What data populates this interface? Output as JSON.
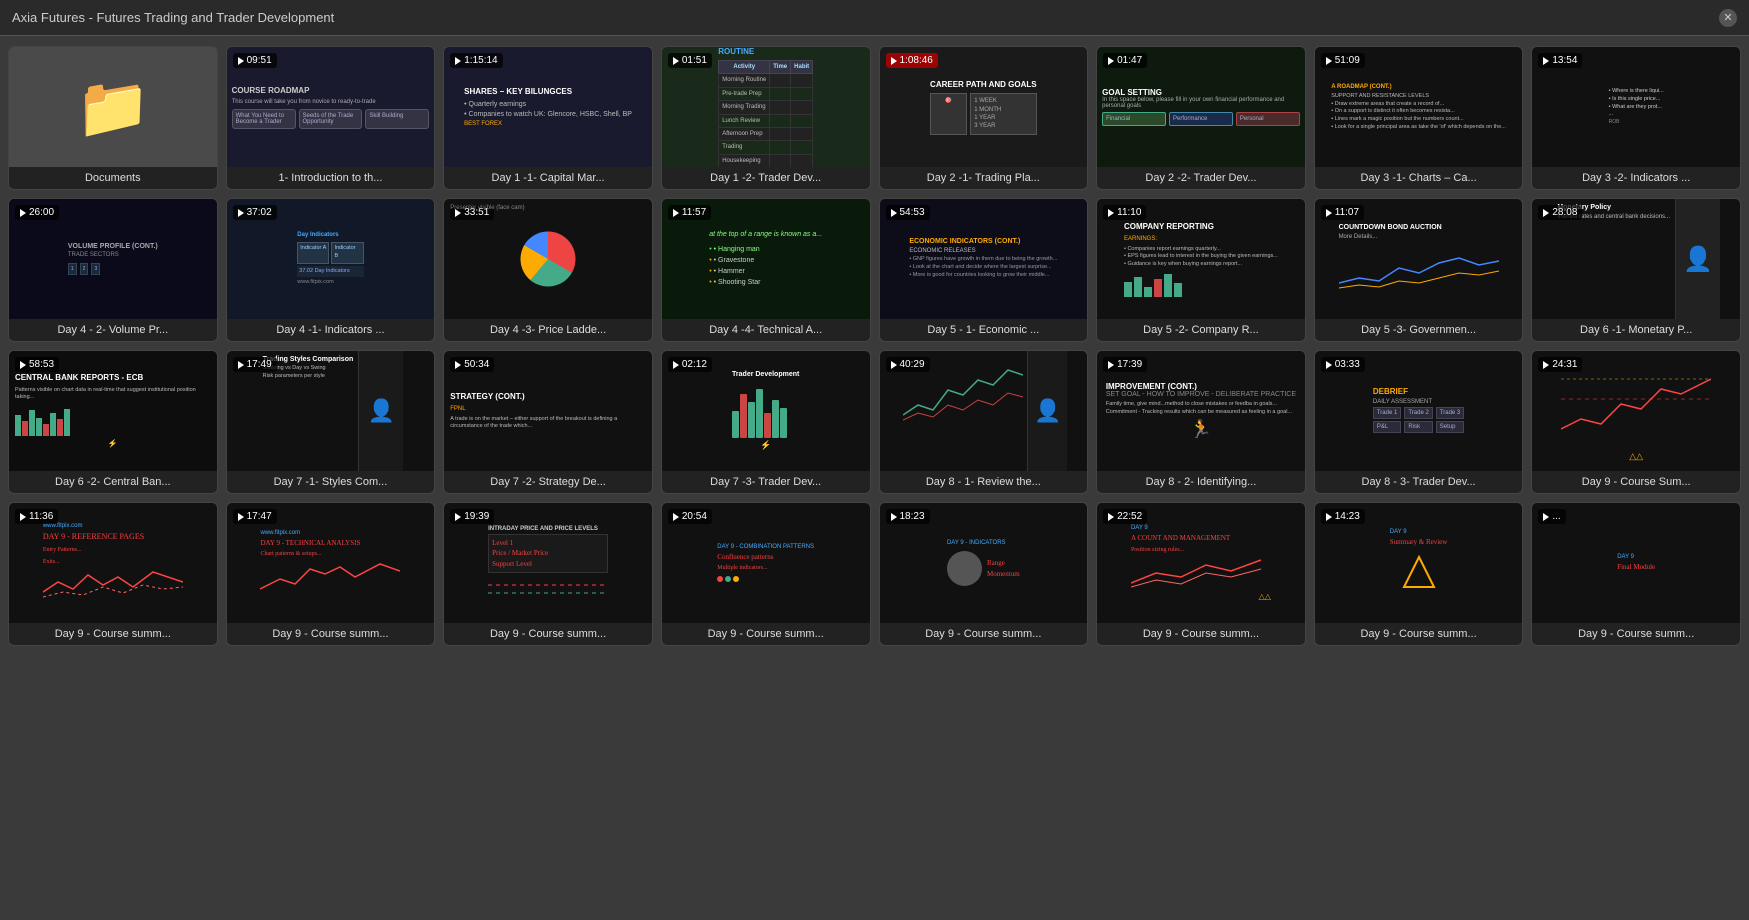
{
  "app": {
    "title": "Axia Futures - Futures Trading and Trader Development"
  },
  "grid": {
    "items": [
      {
        "id": "documents",
        "label": "Documents",
        "duration": null,
        "type": "folder",
        "is_folder": true
      },
      {
        "id": "day1-intro",
        "label": "1- Introduction to th...",
        "duration": "09:51",
        "type": "video",
        "duration_red": false
      },
      {
        "id": "day1-capital",
        "label": "Day 1 -1- Capital Mar...",
        "duration": "1:15:14",
        "type": "video",
        "duration_red": false
      },
      {
        "id": "day1-trader-dev",
        "label": "Day 1 -2- Trader Dev...",
        "duration": "01:51",
        "type": "video",
        "duration_red": false
      },
      {
        "id": "day2-trading-plan",
        "label": "Day 2 -1- Trading Pla...",
        "duration": "1:08:46",
        "type": "video",
        "duration_red": true
      },
      {
        "id": "day2-trader-dev",
        "label": "Day 2 -2- Trader Dev...",
        "duration": "01:47",
        "type": "video",
        "duration_red": false
      },
      {
        "id": "day3-charts",
        "label": "Day 3 -1- Charts – Ca...",
        "duration": "51:09",
        "type": "video",
        "duration_red": false
      },
      {
        "id": "day3-indicators",
        "label": "Day 3 -2- Indicators ...",
        "duration": "13:54",
        "type": "video",
        "duration_red": false
      },
      {
        "id": "day4-volume",
        "label": "Day 4 - 2- Volume Pr...",
        "duration": "26:00",
        "type": "video",
        "duration_red": false
      },
      {
        "id": "day4-indicators",
        "label": "Day 4 -1- Indicators ...",
        "duration": "37:02",
        "type": "video",
        "duration_red": false
      },
      {
        "id": "day4-price-ladder",
        "label": "Day 4 -3- Price Ladde...",
        "duration": "33:51",
        "type": "video",
        "duration_red": false
      },
      {
        "id": "day4-technical",
        "label": "Day 4 -4- Technical A...",
        "duration": "11:57",
        "type": "video",
        "duration_red": false
      },
      {
        "id": "day5-economic",
        "label": "Day 5 - 1- Economic ...",
        "duration": "54:53",
        "type": "video",
        "duration_red": false
      },
      {
        "id": "day5-company",
        "label": "Day 5 -2- Company R...",
        "duration": "11:10",
        "type": "video",
        "duration_red": false
      },
      {
        "id": "day5-government",
        "label": "Day 5 -3- Governmen...",
        "duration": "11:07",
        "type": "video",
        "duration_red": false
      },
      {
        "id": "day6-monetary",
        "label": "Day 6 -1- Monetary P...",
        "duration": "28:08",
        "type": "video",
        "duration_red": false
      },
      {
        "id": "day6-central-bank",
        "label": "Day 6 -2- Central Ban...",
        "duration": "58:53",
        "type": "video",
        "duration_red": false
      },
      {
        "id": "day7-styles",
        "label": "Day 7 -1- Styles Com...",
        "duration": "17:49",
        "type": "video",
        "duration_red": false
      },
      {
        "id": "day7-strategy",
        "label": "Day 7 -2- Strategy De...",
        "duration": "50:34",
        "type": "video",
        "duration_red": false
      },
      {
        "id": "day7-trader-dev",
        "label": "Day 7 -3- Trader Dev...",
        "duration": "02:12",
        "type": "video",
        "duration_red": false
      },
      {
        "id": "day8-review",
        "label": "Day 8 - 1- Review the...",
        "duration": "40:29",
        "type": "video",
        "duration_red": false
      },
      {
        "id": "day8-identifying",
        "label": "Day 8 - 2- Identifying...",
        "duration": "17:39",
        "type": "video",
        "duration_red": false
      },
      {
        "id": "day8-trader-dev",
        "label": "Day 8 - 3- Trader Dev...",
        "duration": "03:33",
        "type": "video",
        "duration_red": false
      },
      {
        "id": "day9-course-sum1",
        "label": "Day 9 - Course Sum...",
        "duration": "24:31",
        "type": "video",
        "duration_red": false
      },
      {
        "id": "day9-course-sum2",
        "label": "Day 9 - Course summ...",
        "duration": "11:36",
        "type": "video",
        "duration_red": false
      },
      {
        "id": "day9-course-sum3",
        "label": "Day 9 - Course summ...",
        "duration": "17:47",
        "type": "video",
        "duration_red": false
      },
      {
        "id": "day9-course-sum4",
        "label": "Day 9 - Course summ...",
        "duration": "19:39",
        "type": "video",
        "duration_red": false
      },
      {
        "id": "day9-course-sum5",
        "label": "Day 9 - Course summ...",
        "duration": "20:54",
        "type": "video",
        "duration_red": false
      },
      {
        "id": "day9-course-sum6",
        "label": "Day 9 - Course summ...",
        "duration": "18:23",
        "type": "video",
        "duration_red": false
      },
      {
        "id": "day9-course-sum7",
        "label": "Day 9 - Course summ...",
        "duration": "22:52",
        "type": "video",
        "duration_red": false
      },
      {
        "id": "day9-course-sum8",
        "label": "Day 9 - Course summ...",
        "duration": "14:23",
        "type": "video",
        "duration_red": false
      },
      {
        "id": "day9-course-sum9",
        "label": "Day 9 - Course summ...",
        "duration": "...",
        "type": "video",
        "duration_red": false
      }
    ]
  }
}
